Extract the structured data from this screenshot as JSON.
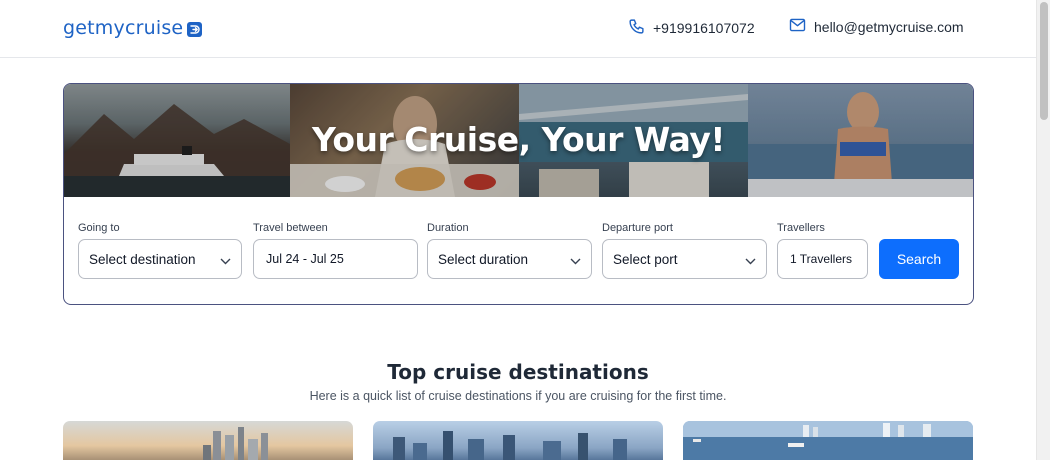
{
  "header": {
    "logo_text": "getmycruise",
    "phone": "+919916107072",
    "email": "hello@getmycruise.com",
    "icons": {
      "phone": "phone-icon",
      "email": "mail-icon",
      "logo": "logo-arrow-icon"
    }
  },
  "hero": {
    "title": "Your Cruise, Your Way!"
  },
  "search": {
    "going_to": {
      "label": "Going to",
      "value": "Select destination"
    },
    "travel_between": {
      "label": "Travel between",
      "value": "Jul 24 - Jul 25"
    },
    "duration": {
      "label": "Duration",
      "value": "Select duration"
    },
    "departure_port": {
      "label": "Departure port",
      "value": "Select port"
    },
    "travellers": {
      "label": "Travellers",
      "value": "1 Travellers"
    },
    "button_label": "Search"
  },
  "destinations": {
    "title": "Top cruise destinations",
    "subtitle": "Here is a quick list of cruise destinations if you are cruising for the first time."
  },
  "colors": {
    "brand": "#1e63c5",
    "accent": "#0d6efd",
    "hero_border": "#4b5280"
  }
}
